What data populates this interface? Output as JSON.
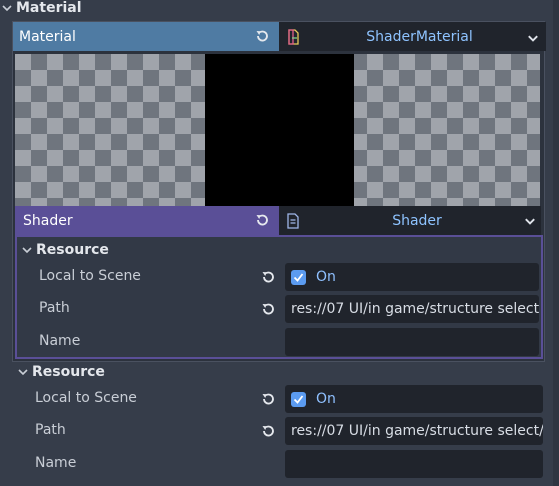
{
  "inspector": {
    "section_title": "Material",
    "material_row": {
      "label": "Material",
      "resource_type": "ShaderMaterial",
      "resource_icon": "shader-material-icon"
    },
    "shader_row": {
      "label": "Shader",
      "resource_type": "Shader",
      "resource_icon": "shader-file-icon"
    },
    "nested_resource": {
      "title": "Resource",
      "local_to_scene": {
        "label": "Local to Scene",
        "value": "On",
        "checked": true
      },
      "path": {
        "label": "Path",
        "value": "res://07 UI/in game/structure select/"
      },
      "name": {
        "label": "Name",
        "value": ""
      }
    },
    "outer_resource": {
      "title": "Resource",
      "local_to_scene": {
        "label": "Local to Scene",
        "value": "On",
        "checked": true
      },
      "path": {
        "label": "Path",
        "value": "res://07 UI/in game/structure select/"
      },
      "name": {
        "label": "Name",
        "value": ""
      }
    }
  },
  "colors": {
    "background": "#363d4a",
    "material_header": "#4f7ba3",
    "shader_header": "#5a4f97",
    "accent": "#5b9bf0"
  }
}
